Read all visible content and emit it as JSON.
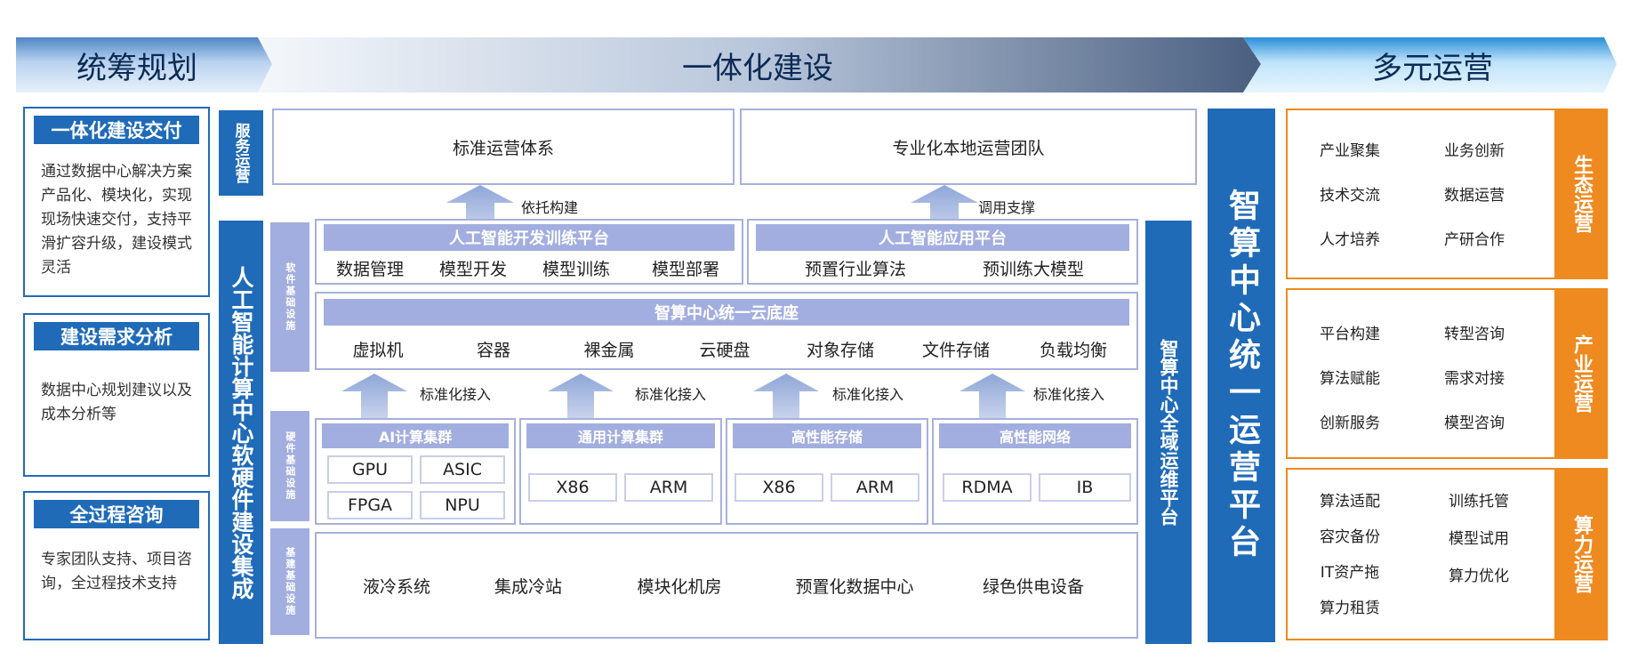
{
  "banners": {
    "left": "统筹规划",
    "center": "一体化建设",
    "right": "多元运营"
  },
  "left_panels": [
    {
      "title": "一体化建设交付",
      "text": "通过数据中心解决方案产品化、模块化，实现现场快速交付，支持平滑扩容升级，建设模式灵活"
    },
    {
      "title": "建设需求分析",
      "text": "数据中心规划建议以及成本分析等"
    },
    {
      "title": "全过程咨询",
      "text": "专家团队支持、项目咨询，全过程技术支持"
    }
  ],
  "vertical_labels": {
    "service_ops": "服务运营",
    "left_integration": "人工智能计算中心软硬件建设集成",
    "software_infra": "软件基础设施",
    "hardware_infra": "硬件基础设施",
    "base_infra": "基建基础设施",
    "global_ops": "智算中心全域运维平台",
    "unified_ops": "智算中心统一运营平台"
  },
  "service_row": {
    "left": "标准运营体系",
    "right": "专业化本地运营团队",
    "arrow_left": "依托构建",
    "arrow_right": "调用支撑"
  },
  "ai_dev_platform": {
    "title": "人工智能开发训练平台",
    "items": [
      "数据管理",
      "模型开发",
      "模型训练",
      "模型部署"
    ]
  },
  "ai_app_platform": {
    "title": "人工智能应用平台",
    "items": [
      "预置行业算法",
      "预训练大模型"
    ]
  },
  "cloud_base": {
    "title": "智算中心统一云底座",
    "items": [
      "虚拟机",
      "容器",
      "裸金属",
      "云硬盘",
      "对象存储",
      "文件存储",
      "负载均衡"
    ]
  },
  "access_arrows": [
    "标准化接入",
    "标准化接入",
    "标准化接入",
    "标准化接入"
  ],
  "hardware_groups": [
    {
      "title": "AI计算集群",
      "items": [
        "GPU",
        "ASIC",
        "FPGA",
        "NPU"
      ]
    },
    {
      "title": "通用计算集群",
      "items": [
        "X86",
        "ARM"
      ]
    },
    {
      "title": "高性能存储",
      "items": [
        "X86",
        "ARM"
      ]
    },
    {
      "title": "高性能网络",
      "items": [
        "RDMA",
        "IB"
      ]
    }
  ],
  "base_items": [
    "液冷系统",
    "集成冷站",
    "模块化机房",
    "预置化数据中心",
    "绿色供电设备"
  ],
  "right_groups": [
    {
      "tab": "生态运营",
      "items": [
        "产业聚集",
        "业务创新",
        "技术交流",
        "数据运营",
        "人才培养",
        "产研合作"
      ]
    },
    {
      "tab": "产业运营",
      "items": [
        "平台构建",
        "转型咨询",
        "算法赋能",
        "需求对接",
        "创新服务",
        "模型咨询"
      ]
    },
    {
      "tab": "算力运营",
      "items": [
        "算法适配",
        "训练托管",
        "容灾备份",
        "模型试用",
        "IT资产拖",
        "算力优化",
        "算力租赁"
      ]
    }
  ],
  "colors": {
    "blue": "#1f6bb8",
    "lavender": "#a2aedf",
    "orange": "#ee8a1f",
    "banner_dark": "#0b2a55"
  }
}
